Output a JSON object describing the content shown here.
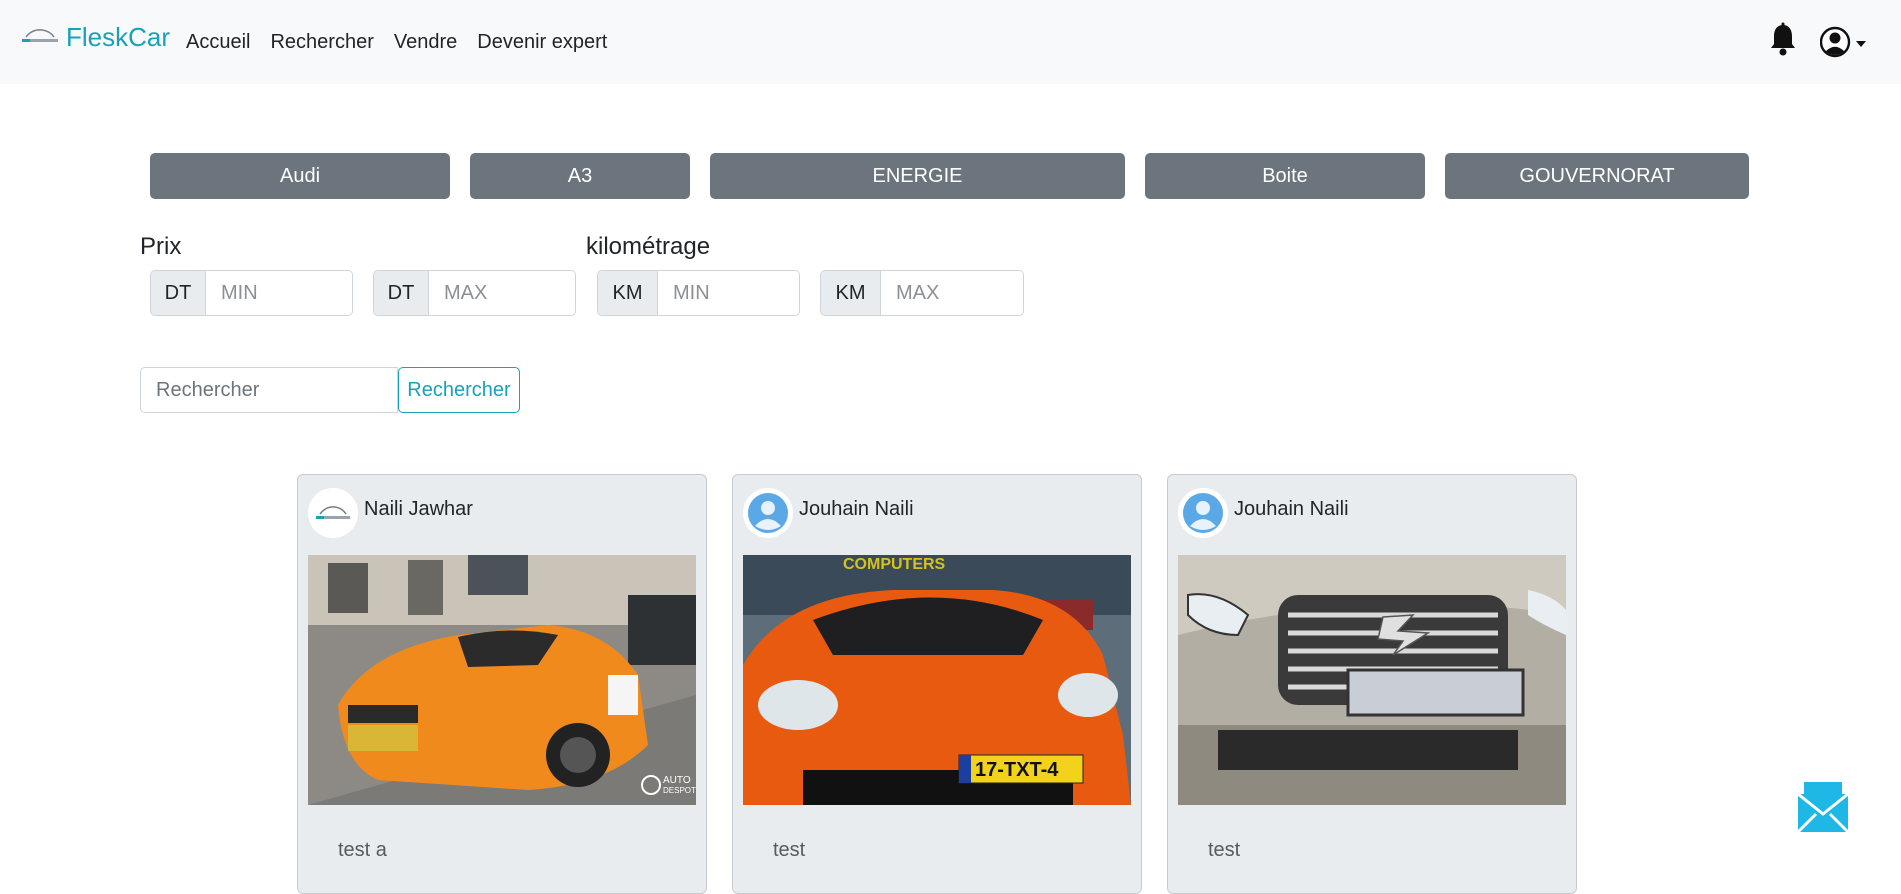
{
  "navbar": {
    "brand": "FleskCar",
    "links": [
      "Accueil",
      "Rechercher",
      "Vendre",
      "Devenir expert"
    ]
  },
  "filters": {
    "buttons": [
      "Audi",
      "A3",
      "ENERGIE",
      "Boite",
      "GOUVERNORAT"
    ],
    "prix": {
      "label": "Prix",
      "min": {
        "prefix": "DT",
        "placeholder": "MIN"
      },
      "max": {
        "prefix": "DT",
        "placeholder": "MAX"
      }
    },
    "km": {
      "label": "kilométrage",
      "min": {
        "prefix": "KM",
        "placeholder": "MIN"
      },
      "max": {
        "prefix": "KM",
        "placeholder": "MAX"
      }
    }
  },
  "search": {
    "placeholder": "Rechercher",
    "button": "Rechercher"
  },
  "cards": [
    {
      "author": "Naili Jawhar",
      "text": "test a",
      "photo_watermark": "AUTO DESPOT"
    },
    {
      "author": "Jouhain Naili",
      "text": "test",
      "plate": "17-TXT-4",
      "sign": "COMPUTERS"
    },
    {
      "author": "Jouhain Naili",
      "text": "test"
    }
  ],
  "colors": {
    "accent": "#17a2b8",
    "button_gray": "#6c757d",
    "card_bg": "#e9ecef"
  }
}
